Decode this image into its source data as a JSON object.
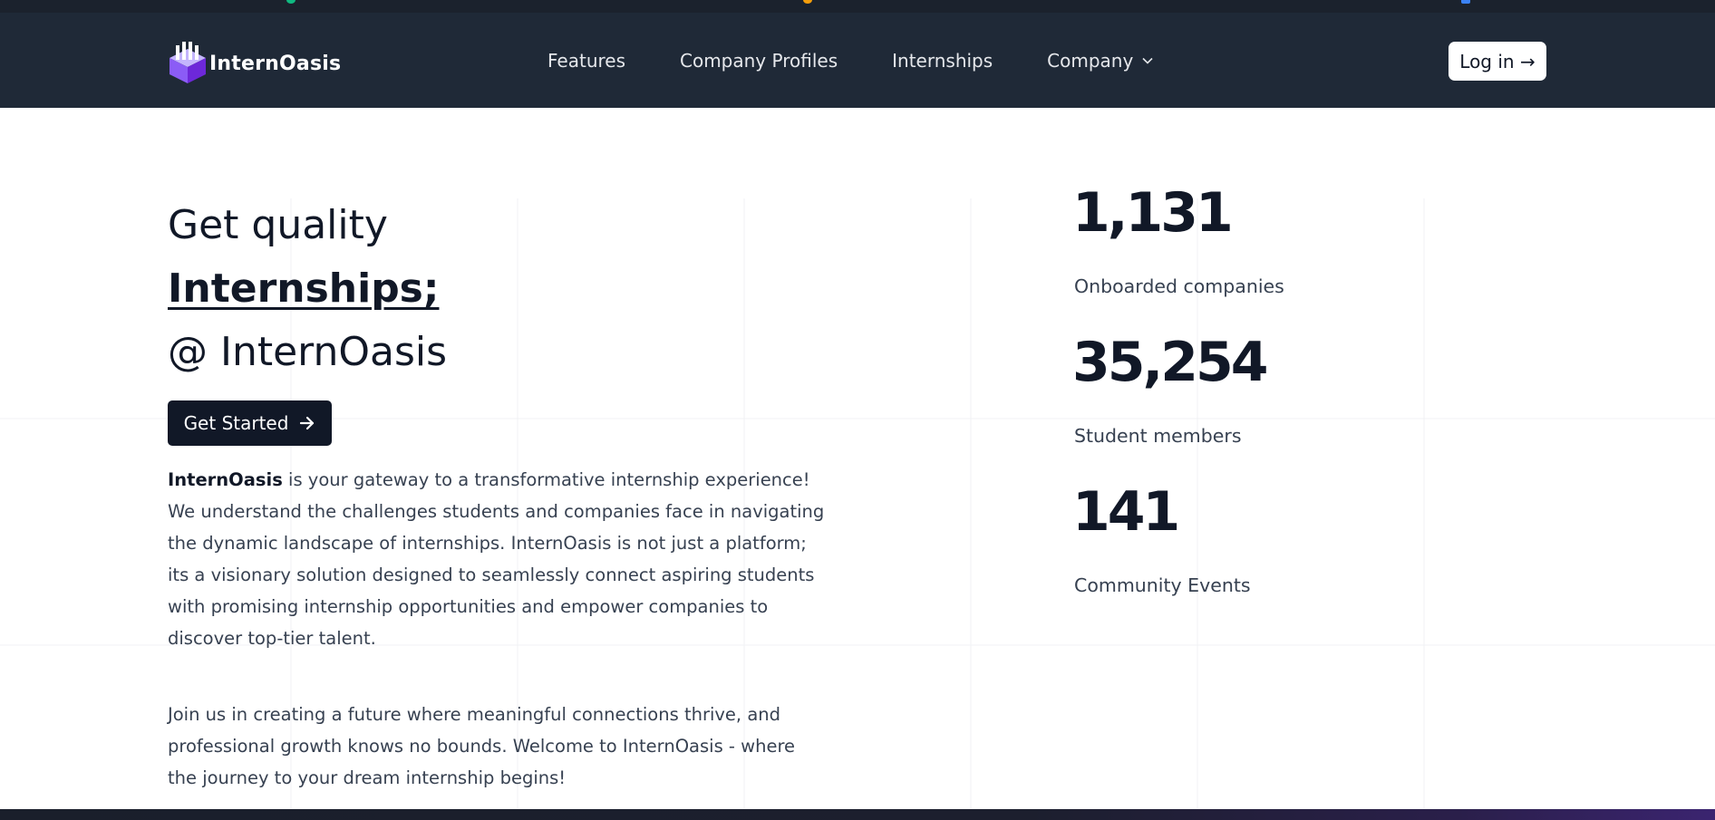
{
  "brand": {
    "name": "InternOasis"
  },
  "nav": {
    "items": [
      "Features",
      "Company Profiles",
      "Internships",
      "Company"
    ],
    "login_label": "Log in →"
  },
  "hero": {
    "line1": "Get quality",
    "line2": "Internships;",
    "line3": "@ InternOasis",
    "cta_label": "Get Started"
  },
  "description": {
    "brand_bold": "InternOasis",
    "paragraph1": " is your gateway to a transformative internship experience! We understand the challenges students and companies face in navigating the dynamic landscape of internships. InternOasis is not just a platform; its a visionary solution designed to seamlessly connect aspiring students with promising internship opportunities and empower companies to discover top-tier talent.",
    "paragraph2": "Join us in creating a future where meaningful connections thrive, and professional growth knows no bounds. Welcome to InternOasis - where the journey to your dream internship begins!"
  },
  "stats": [
    {
      "value": "1,131",
      "label": "Onboarded companies"
    },
    {
      "value": "35,254",
      "label": "Student members"
    },
    {
      "value": "141",
      "label": "Community Events"
    }
  ],
  "colors": {
    "navbar_bg": "#1f2937",
    "button_dark": "#111827",
    "logo_purple": "#8b5cf6"
  },
  "icons": {
    "logo": "cube-logo-icon",
    "dropdown": "chevron-down-icon",
    "cta": "arrow-right-icon"
  }
}
